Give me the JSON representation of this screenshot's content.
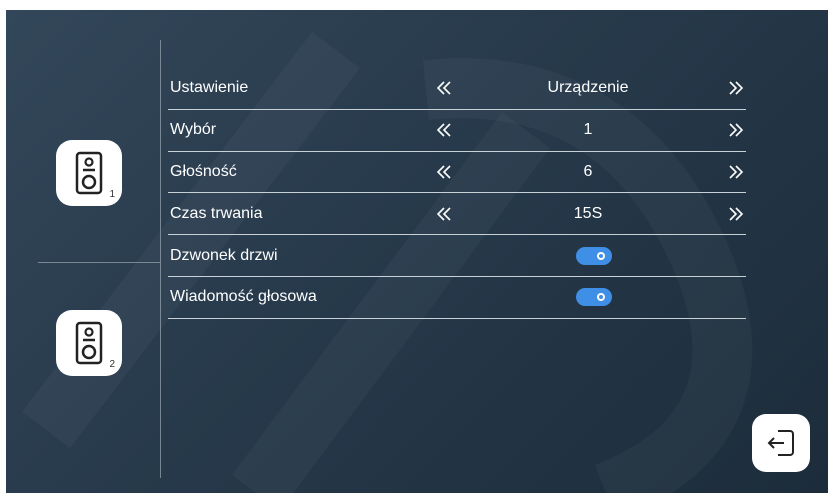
{
  "devices": [
    {
      "number": "1",
      "icon": "doorbell-icon"
    },
    {
      "number": "2",
      "icon": "doorbell-icon"
    }
  ],
  "settings": {
    "rows": [
      {
        "label": "Ustawienie",
        "value": "Urządzenie"
      },
      {
        "label": "Wybór",
        "value": "1"
      },
      {
        "label": "Głośność",
        "value": "6"
      },
      {
        "label": "Czas trwania",
        "value": "15S"
      }
    ],
    "toggles": [
      {
        "label": "Dzwonek drzwi",
        "on": true
      },
      {
        "label": "Wiadomość głosowa",
        "on": true
      }
    ]
  },
  "colors": {
    "background": "#2a3d4f",
    "toggle_on": "#3f8fe6",
    "text": "#ffffff"
  },
  "exit_icon": "exit-icon"
}
